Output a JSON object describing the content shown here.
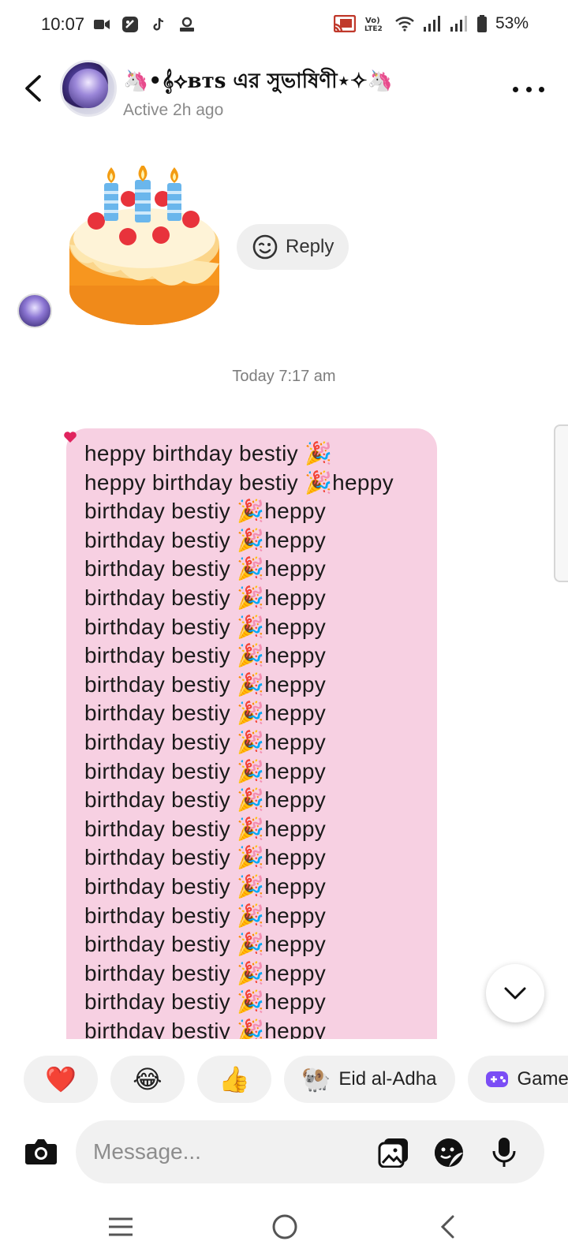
{
  "status_bar": {
    "time": "10:07",
    "battery": "53%",
    "icons": [
      "video-camera-icon",
      "screen-record-icon",
      "tiktok-icon",
      "cleaner-icon",
      "cast-icon",
      "volte-icon",
      "wifi-icon",
      "signal-icon",
      "signal-icon-2",
      "battery-icon"
    ],
    "volte_label": "Vo)\nLTE2"
  },
  "header": {
    "title": "🦄•𝄞⟡ʙᴛs এর সুভাষিণী⋆✧🦄",
    "status": "Active 2h ago"
  },
  "messages": {
    "sticker": "birthday-cake-sticker",
    "reply_label": "Reply",
    "timestamp": "Today 7:17 am",
    "bubble_text": "heppy birthday bestiy 🎉\nheppy birthday bestiy 🎉heppy\nbirthday bestiy 🎉heppy\nbirthday bestiy 🎉heppy\nbirthday bestiy 🎉heppy\nbirthday bestiy 🎉heppy\nbirthday bestiy 🎉heppy\nbirthday bestiy 🎉heppy\nbirthday bestiy 🎉heppy\nbirthday bestiy 🎉heppy\nbirthday bestiy 🎉heppy\nbirthday bestiy 🎉heppy\nbirthday bestiy 🎉heppy\nbirthday bestiy 🎉heppy\nbirthday bestiy 🎉heppy\nbirthday bestiy 🎉heppy\nbirthday bestiy 🎉heppy\nbirthday bestiy 🎉heppy\nbirthday bestiy 🎉heppy\nbirthday bestiy 🎉heppy\nbirthday bestiy 🎉heppy",
    "reaction": "❤"
  },
  "quick_replies": {
    "heart": "❤️",
    "laugh": "😂",
    "thumbs": "👍",
    "eid_emoji": "🐏",
    "eid_label": "Eid al-Adha",
    "games_label": "Games"
  },
  "composer": {
    "placeholder": "Message..."
  },
  "colors": {
    "bubble": "#f7d0e2",
    "chip": "#f1f1f1",
    "heart": "#e0245e"
  }
}
